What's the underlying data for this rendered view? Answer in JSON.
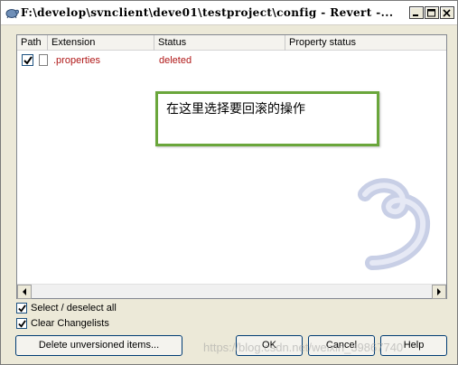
{
  "window": {
    "title": "F:\\develop\\svnclient\\deve01\\testproject\\config - Revert -...",
    "minimize_icon": "minimize-icon",
    "maximize_icon": "maximize-icon",
    "close_icon": "close-icon"
  },
  "listview": {
    "columns": [
      "Path",
      "Extension",
      "Status",
      "Property status"
    ],
    "rows": [
      {
        "checked": true,
        "path": "",
        "extension": ".properties",
        "status": "deleted",
        "property_status": ""
      }
    ]
  },
  "annotation": {
    "text": "在这里选择要回滚的操作",
    "border_color": "#6aa63b"
  },
  "options": {
    "select_all": {
      "label": "Select / deselect all",
      "checked": true
    },
    "clear_changelists": {
      "label": "Clear Changelists",
      "checked": true
    }
  },
  "buttons": {
    "delete_unversioned": "Delete unversioned items...",
    "ok": "OK",
    "cancel": "Cancel",
    "help": "Help"
  },
  "watermark": "https://blog.csdn.net/weixin_39867740",
  "colors": {
    "status_deleted": "#b01818",
    "accent_border": "#003c74"
  }
}
